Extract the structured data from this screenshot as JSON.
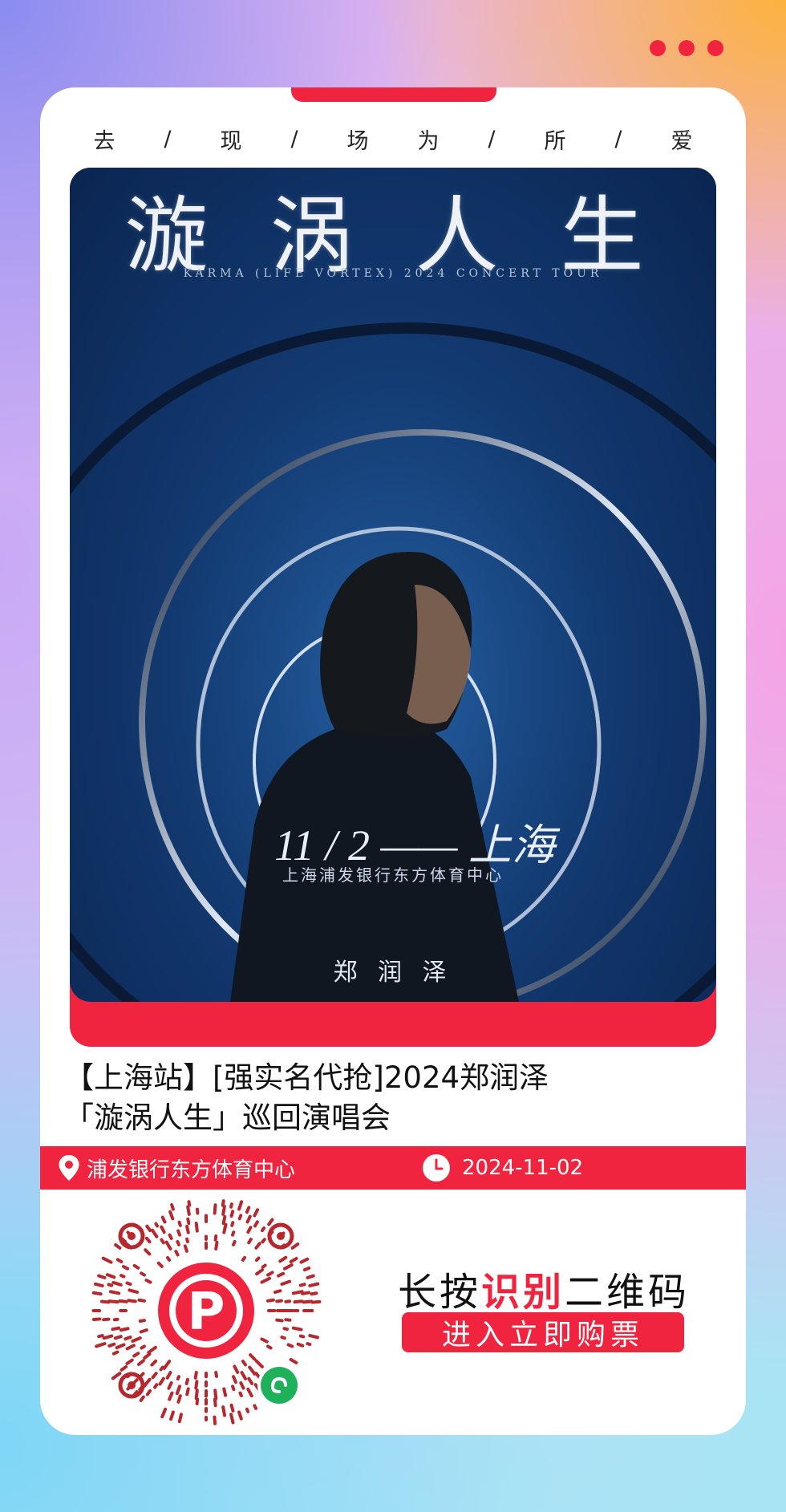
{
  "header": {
    "more_icon": "three-dots-icon",
    "slogan": [
      "去",
      "/",
      "现",
      "/",
      "场",
      "为",
      "/",
      "所",
      "/",
      "爱"
    ]
  },
  "poster": {
    "title": "漩 涡 人 生",
    "subtitle": "KARMA (LIFE VORTEX) 2024 CONCERT TOUR",
    "date_line": "11 / 2 —— 上海",
    "venue": "上海浦发银行东方体育中心",
    "artist": "郑 润 泽"
  },
  "event": {
    "title": "【上海站】[强实名代抢]2024郑润泽「漩涡人生」巡回演唱会",
    "location": "浦发银行东方体育中心",
    "location_icon": "map-pin-icon",
    "date": "2024-11-02",
    "clock_icon": "clock-icon"
  },
  "cta": {
    "prefix": "长按",
    "highlight": "识别",
    "suffix": "二维码",
    "button_label": "进入立即购票",
    "qr_icon": "mini-program-qr-code"
  },
  "colors": {
    "accent": "#f0243f",
    "poster_bg": "#123a72"
  }
}
